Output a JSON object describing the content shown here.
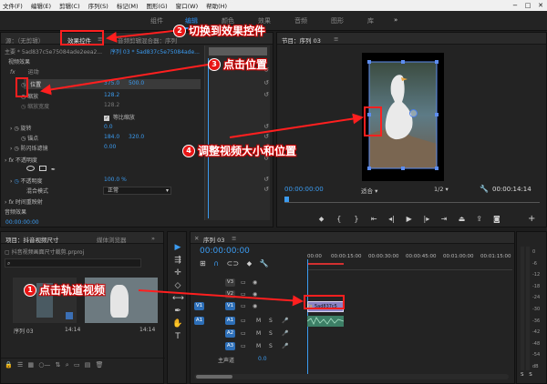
{
  "menu": [
    "文件(F)",
    "编辑(E)",
    "剪辑(C)",
    "序列(S)",
    "标记(M)",
    "图形(G)",
    "窗口(W)",
    "帮助(H)"
  ],
  "workspaces": [
    {
      "label": "组件",
      "active": false
    },
    {
      "label": "编辑",
      "active": true
    },
    {
      "label": "颜色",
      "active": false
    },
    {
      "label": "效果",
      "active": false
    },
    {
      "label": "音频",
      "active": false
    },
    {
      "label": "图形",
      "active": false
    },
    {
      "label": "库",
      "active": false
    }
  ],
  "workspace_more": "»",
  "effects_panel": {
    "tab_source": "源：（无剪辑）",
    "tab_effects": "效果控件",
    "tab_menu": "≡",
    "tab_mixer": "音频剪辑混合器：序列",
    "clip_master": "主要 * 5ad837c5e75084ade2eea2...",
    "clip_seq": "序列 03 * 5ad837c5e75084ade...",
    "section_video": "视频效果",
    "motion": "运动",
    "position_label": "位置",
    "position_x": "375.0",
    "position_y": "500.0",
    "scale_label": "缩放",
    "scale_value": "128.2",
    "scale_width_label": "缩放宽度",
    "scale_width_value": "128.2",
    "uniform_scale_label": "等比缩放",
    "rotation_label": "旋转",
    "rotation_value": "0.0",
    "anchor_label": "锚点",
    "anchor_x": "184.0",
    "anchor_y": "320.0",
    "antiflicker_label": "防闪烁滤镜",
    "antiflicker_value": "0.00",
    "opacity_section": "不透明度",
    "opacity_label": "不透明度",
    "opacity_value": "100.0 %",
    "blend_label": "混合模式",
    "blend_value": "正常",
    "time_remap": "时间重映射",
    "section_audio": "音频效果",
    "timecode": "00:00:00:00",
    "fx": "fx"
  },
  "program_monitor": {
    "title": "节目：序列 03",
    "menu": "≡",
    "timecode": "00:00:00:00",
    "fit": "适合",
    "quality": "1/2",
    "duration": "00:00:14:14"
  },
  "project_panel": {
    "tab_project": "项目：抖音视频尺寸",
    "tab_browser": "媒体浏览器",
    "more": "»",
    "file_name": "抖音视频画面尺寸裁剪.prproj",
    "item1_name": "序列 03",
    "item1_dur": "14:14",
    "item2_dur": "14:14"
  },
  "timeline": {
    "tab": "序列 03",
    "menu": "≡",
    "timecode": "00:00:00:00",
    "ruler": [
      "00:00",
      "00:00:15:00",
      "00:00:30:00",
      "00:00:45:00",
      "00:01:00:00",
      "00:01:15:00"
    ],
    "tracks_video": [
      "V3",
      "V2",
      "V1"
    ],
    "tracks_audio": [
      "A1",
      "A2",
      "A3"
    ],
    "master": "主声道",
    "master_value": "0.0",
    "clip_label": "5ad837c5"
  },
  "meter_scale": [
    "0",
    "-6",
    "-12",
    "-18",
    "-24",
    "-30",
    "-36",
    "-42",
    "-48",
    "-54",
    "dB"
  ],
  "callouts": [
    {
      "num": "1",
      "text": "点击轨道视频"
    },
    {
      "num": "2",
      "text": "切换到效果控件"
    },
    {
      "num": "3",
      "text": "点击位置"
    },
    {
      "num": "4",
      "text": "调整视频大小和位置"
    }
  ],
  "colors": {
    "accent": "#2d8ceb",
    "callout_red": "#ff1f1f",
    "value_blue": "#3b9bf0",
    "video_clip": "#8b82c4",
    "audio_clip": "#3d7f66"
  }
}
